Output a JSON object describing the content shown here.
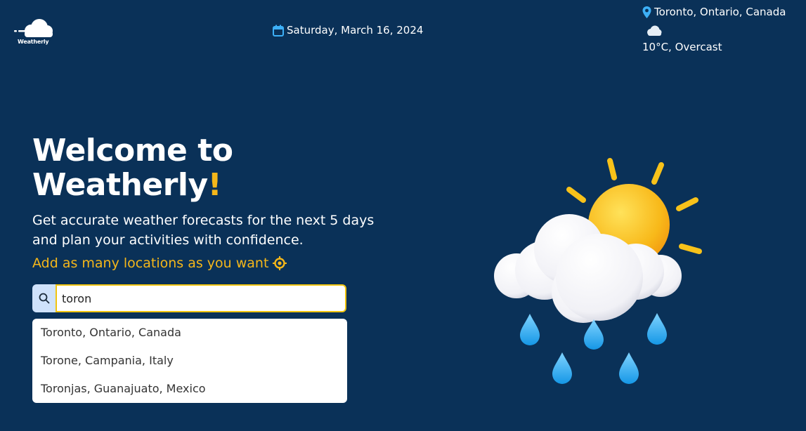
{
  "brand": {
    "logo_text": "Weatherly"
  },
  "header": {
    "date": "Saturday, March 16, 2024",
    "current_location": "Toronto, Ontario, Canada",
    "current_weather_icon": "cloud-icon",
    "current_condition": "10°C, Overcast"
  },
  "hero": {
    "title_line1": "Welcome to",
    "title_line2": "Weatherly",
    "title_accent": "!",
    "subtitle_line1": "Get accurate weather forecasts for the next 5 days",
    "subtitle_line2": "and plan your activities with confidence.",
    "add_locations": "Add as many locations as you want"
  },
  "search": {
    "value": "toron",
    "icon": "search-icon"
  },
  "suggestions": [
    {
      "label": "Toronto, Ontario, Canada"
    },
    {
      "label": "Torone, Campania, Italy"
    },
    {
      "label": "Toronjas, Guanajuato, Mexico"
    }
  ],
  "colors": {
    "background": "#0a3158",
    "accent": "#f5b71a",
    "search_border": "#f1c40f",
    "icon_blue": "#3db0f7"
  }
}
